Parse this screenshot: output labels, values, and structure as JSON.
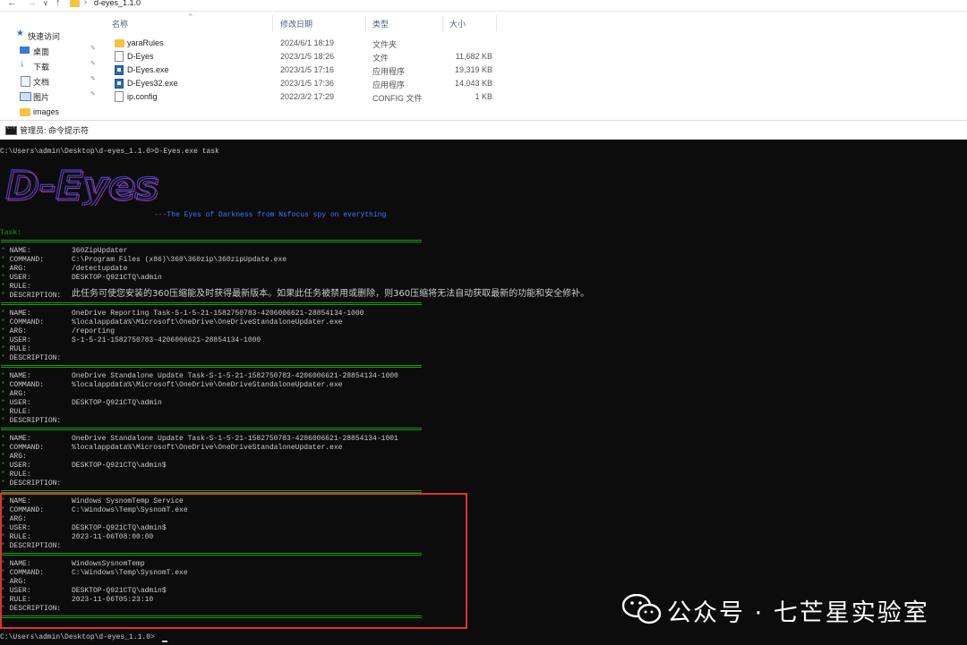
{
  "explorer": {
    "path": "d-eyes_1.1.0",
    "sidebar": [
      {
        "label": "快速访问",
        "icon": "star-icon",
        "pinned": false
      },
      {
        "label": "桌面",
        "icon": "desktop-icon",
        "pinned": true
      },
      {
        "label": "下载",
        "icon": "download-icon",
        "pinned": true
      },
      {
        "label": "文档",
        "icon": "document-icon",
        "pinned": true
      },
      {
        "label": "图片",
        "icon": "picture-icon",
        "pinned": true
      },
      {
        "label": "images",
        "icon": "folder-icon",
        "pinned": false
      }
    ],
    "columns": {
      "name": "名称",
      "date": "修改日期",
      "type": "类型",
      "size": "大小"
    },
    "files": [
      {
        "name": "yaraRules",
        "date": "2024/6/1 18:19",
        "type": "文件夹",
        "size": "",
        "icon": "folder-icon"
      },
      {
        "name": "D-Eyes",
        "date": "2023/1/5 18:26",
        "type": "文件",
        "size": "11,682 KB",
        "icon": "file-icon"
      },
      {
        "name": "D-Eyes.exe",
        "date": "2023/1/5 17:16",
        "type": "应用程序",
        "size": "19,319 KB",
        "icon": "exe-icon"
      },
      {
        "name": "D-Eyes32.exe",
        "date": "2023/1/5 17:36",
        "type": "应用程序",
        "size": "14,043 KB",
        "icon": "exe-icon"
      },
      {
        "name": "ip.config",
        "date": "2022/3/2 17:29",
        "type": "CONFIG 文件",
        "size": "1 KB",
        "icon": "file-icon"
      }
    ]
  },
  "cmd": {
    "title": "管理员: 命令提示符",
    "prompt_command": "C:\\Users\\admin\\Desktop\\d-eyes_1.1.0>D-Eyes.exe task",
    "logo_text": "D-Eyes",
    "tagline": "---The Eyes of Darkness from Nsfocus spy on everything",
    "task_header": "Task:",
    "labels": {
      "name": "NAME:",
      "command": "COMMAND:",
      "arg": "ARG:",
      "user": "USER:",
      "rule": "RULE:",
      "description": "DESCRIPTION:"
    },
    "tasks": [
      {
        "name": "360ZipUpdater",
        "command": "C:\\Program Files (x86)\\360\\360zip\\360zipUpdate.exe",
        "arg": "/detectupdate",
        "user": "DESKTOP-Q921CTQ\\admin",
        "rule": "",
        "description": "此任务可使您安装的360压缩能及时获得最新版本。如果此任务被禁用或删除，则360压缩将无法自动获取最新的功能和安全修补。"
      },
      {
        "name": "OneDrive Reporting Task-S-1-5-21-1582750783-4206006621-28854134-1000",
        "command": "%localappdata%\\Microsoft\\OneDrive\\OneDriveStandaloneUpdater.exe",
        "arg": "/reporting",
        "user": "S-1-5-21-1582750783-4206006621-28854134-1000",
        "rule": "",
        "description": ""
      },
      {
        "name": "OneDrive Standalone Update Task-S-1-5-21-1582750783-4206006621-28854134-1000",
        "command": "%localappdata%\\Microsoft\\OneDrive\\OneDriveStandaloneUpdater.exe",
        "arg": "",
        "user": "DESKTOP-Q921CTQ\\admin",
        "rule": "",
        "description": ""
      },
      {
        "name": "OneDrive Standalone Update Task-S-1-5-21-1582750783-4206006621-28854134-1001",
        "command": "%localappdata%\\Microsoft\\OneDrive\\OneDriveStandaloneUpdater.exe",
        "arg": "",
        "user": "DESKTOP-Q921CTQ\\admin$",
        "rule": "",
        "description": ""
      },
      {
        "name": "Windows SysnomTemp Service",
        "command": "C:\\Windows\\Temp\\SysnomT.exe",
        "arg": "",
        "user": "DESKTOP-Q921CTQ\\admin$",
        "rule": "2023-11-06T08:00:00",
        "description": ""
      },
      {
        "name": "WindowsSysnomTemp",
        "command": "C:\\Windows\\Temp\\SysnomT.exe",
        "arg": "",
        "user": "DESKTOP-Q921CTQ\\admin$",
        "rule": "2023-11-06T05:23:10",
        "description": ""
      }
    ],
    "final_prompt": "C:\\Users\\admin\\Desktop\\d-eyes_1.1.0>"
  },
  "watermark": {
    "text": "公众号 · 七芒星实验室",
    "icon": "wechat-icon"
  },
  "colors": {
    "console_bg": "#0c0c0c",
    "console_fg": "#cccccc",
    "green": "#13a10e",
    "blue": "#3b78ff",
    "highlight": "#e0312f",
    "folder": "#f6c342"
  }
}
